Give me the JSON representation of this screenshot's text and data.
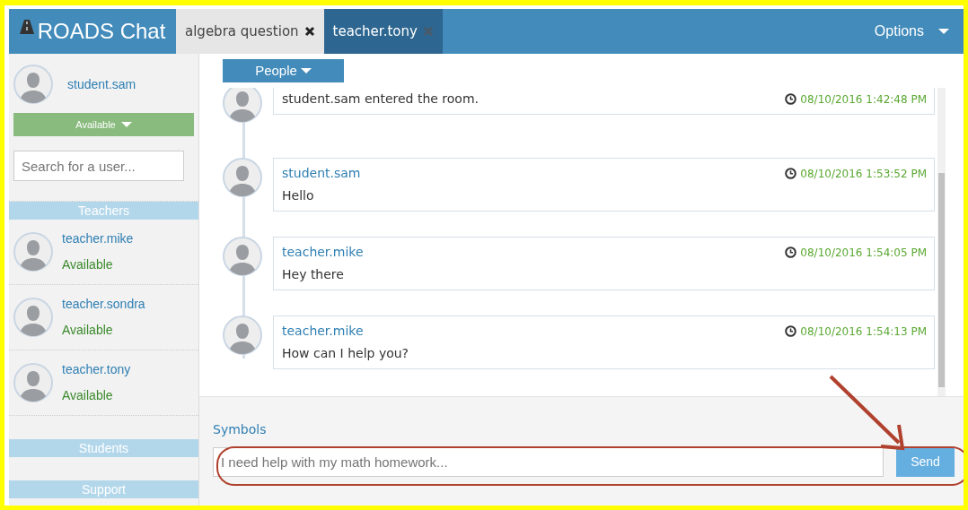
{
  "app": {
    "title": "ROADS Chat"
  },
  "tabs": [
    {
      "label": "algebra question",
      "selected": false
    },
    {
      "label": "teacher.tony",
      "selected": true
    }
  ],
  "options_menu": {
    "label": "Options"
  },
  "user": {
    "name": "student.sam",
    "status": "Available"
  },
  "search": {
    "placeholder": "Search for a user..."
  },
  "groups": [
    {
      "title": "Teachers",
      "users": [
        {
          "name": "teacher.mike",
          "status": "Available"
        },
        {
          "name": "teacher.sondra",
          "status": "Available"
        },
        {
          "name": "teacher.tony",
          "status": "Available"
        }
      ]
    },
    {
      "title": "Students"
    },
    {
      "title": "Support"
    }
  ],
  "people_button": {
    "label": "People"
  },
  "messages": [
    {
      "kind": "event",
      "text": "student.sam entered the room.",
      "time": "08/10/2016 1:42:48 PM"
    },
    {
      "kind": "chat",
      "author": "student.sam",
      "text": "Hello",
      "time": "08/10/2016 1:53:52 PM"
    },
    {
      "kind": "chat",
      "author": "teacher.mike",
      "text": "Hey there",
      "time": "08/10/2016 1:54:05 PM"
    },
    {
      "kind": "chat",
      "author": "teacher.mike",
      "text": "How can I help you?",
      "time": "08/10/2016 1:54:13 PM"
    }
  ],
  "composer": {
    "symbols_label": "Symbols",
    "placeholder": "I need help with my math homework...",
    "send_label": "Send"
  }
}
